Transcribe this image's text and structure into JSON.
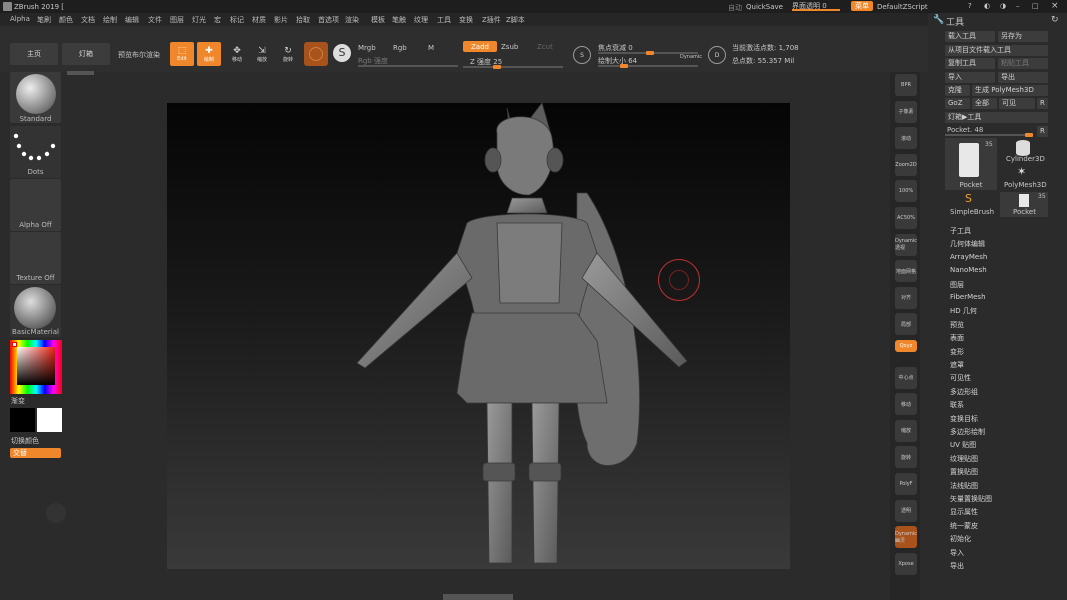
{
  "titlebar": {
    "app_title": "ZBrush 2019 [",
    "autosave": "自动",
    "quicksave": "QuickSave",
    "opacity": "界面透明 0",
    "menu": "菜单",
    "zscript": "DefaultZScript"
  },
  "menubar": [
    "Alpha",
    "笔刷",
    "颜色",
    "文档",
    "绘制",
    "编辑",
    "文件",
    "图层",
    "灯光",
    "宏",
    "标记",
    "材质",
    "影片",
    "拾取",
    "首选项",
    "渲染",
    "模板",
    "笔触",
    "纹理",
    "工具",
    "变换",
    "Z插件",
    "Z脚本"
  ],
  "shelf": {
    "home": "主页",
    "lightbox": "灯箱",
    "bpr": "预览布尔渲染",
    "edit": "Edit",
    "draw": "绘制",
    "move": "移动",
    "scale": "缩放",
    "rotate": "旋转",
    "mrgb": "Mrgb",
    "rgb": "Rgb",
    "m": "M",
    "rgb_intensity": "Rgb 强度",
    "zadd": "Zadd",
    "zsub": "Zsub",
    "zcut": "Zcut",
    "z_intensity": "Z 强度 25",
    "focal": "焦点衰减 0",
    "draw_size": "绘制大小 64",
    "dynamic": "Dynamic",
    "active_points": "当前激活点数: 1,708",
    "total_points": "总点数: 55.357 Mil"
  },
  "left": {
    "brush": "Standard",
    "stroke": "Dots",
    "alpha": "Alpha Off",
    "texture": "Texture Off",
    "material": "BasicMaterial",
    "gradient": "渐变",
    "switch_color": "切换颜色",
    "alternate": "交替"
  },
  "right_shelf": [
    "BPR",
    "子像素",
    "滚动",
    "Zoom2D",
    "100%",
    "AC50%",
    "Dynamic 透视",
    "地面网格",
    "对齐",
    "局部",
    "Qxyz",
    "中心点",
    "移动",
    "缩放",
    "旋转",
    "PolyF",
    "透明",
    "Dynamic 幽灵",
    "Xpose"
  ],
  "tool": {
    "header": "工具",
    "load": "载入工具",
    "saveas": "另存为",
    "load_project": "从项目文件载入工具",
    "copy": "复制工具",
    "paste": "粘贴工具",
    "import": "导入",
    "export": "导出",
    "clone": "克隆",
    "make_polymesh": "生成 PolyMesh3D",
    "goz": "GoZ",
    "all": "全部",
    "visible": "可见",
    "r": "R",
    "lightbox_tool": "灯箱▶工具",
    "pocket_slider": "Pocket. 48",
    "tools": [
      {
        "name": "Pocket",
        "count": "35"
      },
      {
        "name": "Cylinder3D",
        "count": ""
      },
      {
        "name": "PolyMesh3D",
        "count": ""
      },
      {
        "name": "SimpleBrush",
        "count": ""
      },
      {
        "name": "Pocket",
        "count": "35"
      }
    ],
    "subpalettes": [
      "子工具",
      "几何体编辑",
      "ArrayMesh",
      "NanoMesh",
      "图层",
      "FiberMesh",
      "HD 几何",
      "预览",
      "表面",
      "变形",
      "遮罩",
      "可见性",
      "多边形组",
      "联系",
      "变换目标",
      "多边形绘制",
      "UV 贴图",
      "纹理贴图",
      "置换贴图",
      "法线贴图",
      "矢量置换贴图",
      "显示属性",
      "统一蒙皮",
      "初始化",
      "导入",
      "导出"
    ]
  }
}
